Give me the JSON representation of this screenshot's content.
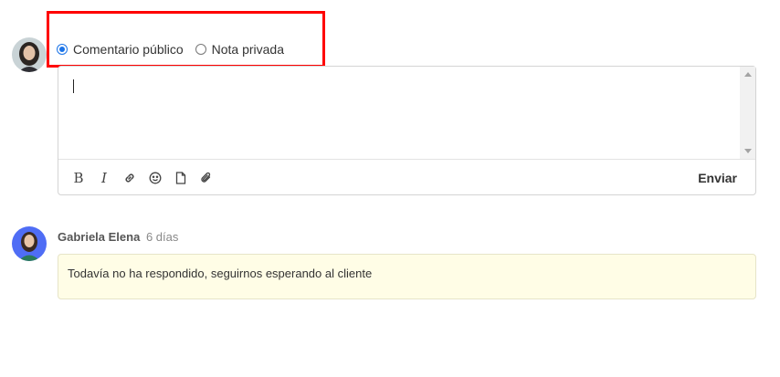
{
  "composer": {
    "avatar_icon": "user-avatar-woman-dark-hair",
    "mode_options": [
      {
        "label": "Comentario público",
        "selected": true
      },
      {
        "label": "Nota privada",
        "selected": false
      }
    ],
    "text_value": "",
    "toolbar_icons": [
      "bold-icon",
      "italic-icon",
      "link-icon",
      "emoji-icon",
      "file-icon",
      "attachment-icon"
    ],
    "send_label": "Enviar"
  },
  "comment": {
    "avatar_icon": "user-avatar-woman-blue-background",
    "author": "Gabriela Elena",
    "time": "6 días",
    "text": "Todavía no ha respondido, seguirnos esperando al cliente"
  },
  "colors": {
    "highlight_border": "#ff0000",
    "radio_accent": "#1a73e8",
    "note_background": "#fffde6"
  }
}
